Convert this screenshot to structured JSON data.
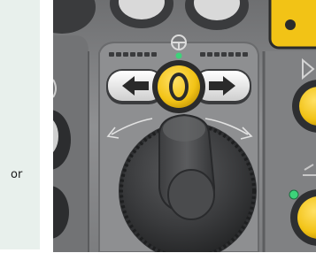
{
  "side_panel": {
    "text": "or"
  },
  "photo": {
    "subject": "joystick-control-panel",
    "colors": {
      "panel": "#8b8c8e",
      "panel_dark": "#5c5d5f",
      "knob": "#3b3c3e",
      "yellow": "#f2c316",
      "green_led": "#3dd37a",
      "white_key": "#eceaea",
      "arrow_key_dark": "#2a2a2a"
    }
  }
}
